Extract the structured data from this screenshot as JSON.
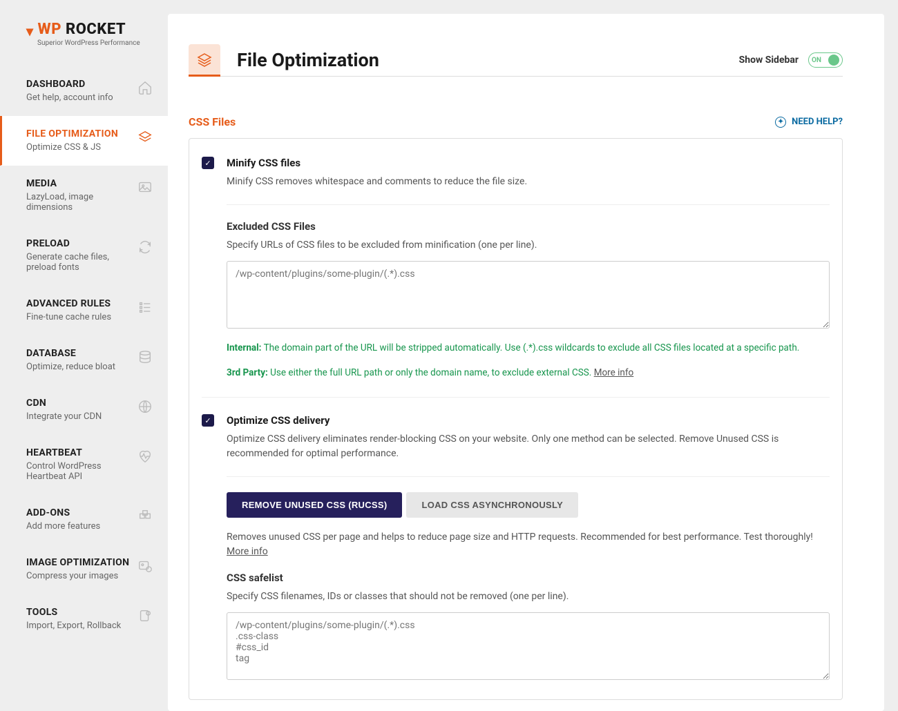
{
  "brand": {
    "word1": "WP",
    "word2": "ROCKET",
    "tagline": "Superior WordPress Performance"
  },
  "sidebar": {
    "items": [
      {
        "title": "DASHBOARD",
        "desc": "Get help, account info"
      },
      {
        "title": "FILE OPTIMIZATION",
        "desc": "Optimize CSS & JS"
      },
      {
        "title": "MEDIA",
        "desc": "LazyLoad, image dimensions"
      },
      {
        "title": "PRELOAD",
        "desc": "Generate cache files, preload fonts"
      },
      {
        "title": "ADVANCED RULES",
        "desc": "Fine-tune cache rules"
      },
      {
        "title": "DATABASE",
        "desc": "Optimize, reduce bloat"
      },
      {
        "title": "CDN",
        "desc": "Integrate your CDN"
      },
      {
        "title": "HEARTBEAT",
        "desc": "Control WordPress Heartbeat API"
      },
      {
        "title": "ADD-ONS",
        "desc": "Add more features"
      },
      {
        "title": "IMAGE OPTIMIZATION",
        "desc": "Compress your images"
      },
      {
        "title": "TOOLS",
        "desc": "Import, Export, Rollback"
      }
    ]
  },
  "page": {
    "title": "File Optimization",
    "show_sidebar_label": "Show Sidebar",
    "toggle_state": "ON"
  },
  "section": {
    "title": "CSS Files",
    "help": "NEED HELP?"
  },
  "minify": {
    "title": "Minify CSS files",
    "desc": "Minify CSS removes whitespace and comments to reduce the file size.",
    "excluded_title": "Excluded CSS Files",
    "excluded_desc": "Specify URLs of CSS files to be excluded from minification (one per line).",
    "excluded_placeholder": "/wp-content/plugins/some-plugin/(.*).css",
    "hint_internal_label": "Internal:",
    "hint_internal": " The domain part of the URL will be stripped automatically. Use (.*).css wildcards to exclude all CSS files located at a specific path.",
    "hint_3rd_label": "3rd Party:",
    "hint_3rd": " Use either the full URL path or only the domain name, to exclude external CSS. ",
    "more_info": "More info"
  },
  "optimize": {
    "title": "Optimize CSS delivery",
    "desc": "Optimize CSS delivery eliminates render-blocking CSS on your website. Only one method can be selected. Remove Unused CSS is recommended for optimal performance.",
    "btn_rucss": "REMOVE UNUSED CSS (RUCSS)",
    "btn_async": "LOAD CSS ASYNCHRONOUSLY",
    "result_desc": "Removes unused CSS per page and helps to reduce page size and HTTP requests. Recommended for best performance. Test thoroughly! ",
    "more_info": "More info",
    "safelist_title": "CSS safelist",
    "safelist_desc": "Specify CSS filenames, IDs or classes that should not be removed (one per line).",
    "safelist_placeholder": "/wp-content/plugins/some-plugin/(.*).css\n.css-class\n#css_id\ntag"
  }
}
